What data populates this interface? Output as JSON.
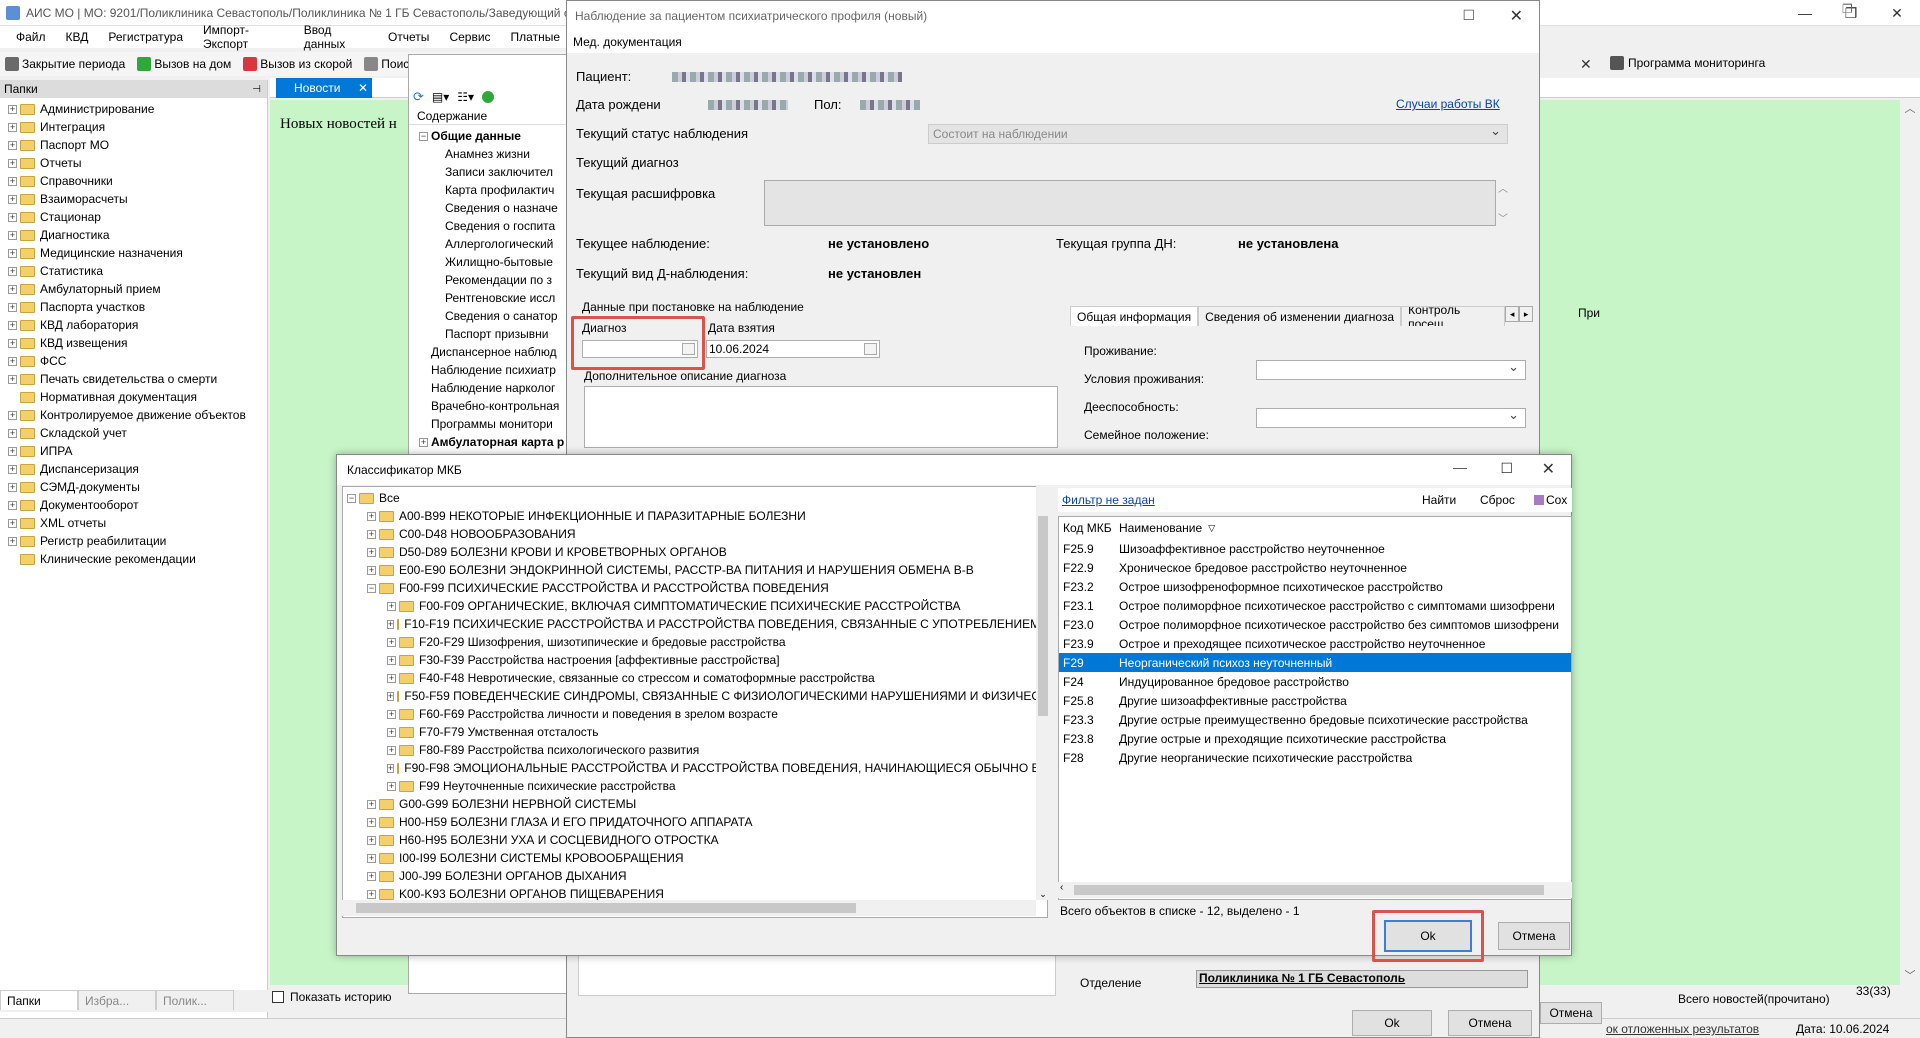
{
  "main_window": {
    "title": "АИС МО | МО: 9201/Поликлиника Севастополь/Поликлиника № 1 ГБ Севастополь/Заведующий с",
    "menu": [
      "Файл",
      "КВД",
      "Регистратура",
      "Импорт-Экспорт",
      "Ввод данных",
      "Отчеты",
      "Сервис",
      "Платные"
    ],
    "toolbar": [
      "Закрытие периода",
      "Вызов на дом",
      "Вызов из скорой",
      "Поиск"
    ],
    "right_toolbar": "Программа мониторинга"
  },
  "folders_panel": {
    "header": "Папки",
    "items": [
      "Администрирование",
      "Интеграция",
      "Паспорт МО",
      "Отчеты",
      "Справочники",
      "Взаиморасчеты",
      "Стационар",
      "Диагностика",
      "Медицинские назначения",
      "Статистика",
      "Амбулаторный прием",
      "Паспорта участков",
      "КВД лаборатория",
      "КВД извещения",
      "ФСС",
      "Печать свидетельства о смерти",
      "Нормативная документация",
      "Контролируемое движение объектов",
      "Складской учет",
      "ИПРА",
      "Диспансеризация",
      "СЭМД-документы",
      "Документооборот",
      "XML отчеты",
      "Регистр реабилитации",
      "Клинические рекомендации"
    ],
    "bottom_tabs": [
      "Папки",
      "Избра...",
      "Полик..."
    ]
  },
  "news": {
    "tab": "Новости",
    "text": "Новых новостей н",
    "show_history": "Показать историю",
    "read_count": "Всего новостей(прочитано)",
    "count": "33(33)"
  },
  "status_bar": {
    "deferred": "ок отложенных результатов",
    "date": "Дата: 10.06.2024"
  },
  "content_panel": {
    "header": "Содержание",
    "root": "Общие данные",
    "children": [
      "Анамнез жизни",
      "Записи заключител",
      "Карта профилактич",
      "Сведения о назначе",
      "Сведения о госпита",
      "Аллергологический",
      "Жилищно-бытовые",
      "Рекомендации по з",
      "Рентгеновские иссл",
      "Сведения о санатор",
      "Паспорт призывни"
    ],
    "others": [
      "Диспансерное наблюд",
      "Наблюдение психиатр",
      "Наблюдение нарколог",
      "Врачебно-контрольная",
      "Программы монитори"
    ],
    "last": "Амбулаторная карта р"
  },
  "observation_dialog": {
    "title": "Наблюдение за пациентом психиатрического профиля (новый)",
    "menu": "Мед. документация",
    "patient_label": "Пациент:",
    "dob_label": "Дата рождени",
    "sex_label": "Пол:",
    "vk_link": "Случаи работы ВК",
    "status_label": "Текущий статус наблюдения",
    "status_value": "Состоит на наблюдении",
    "diag_label": "Текущий диагноз",
    "decode_label": "Текущая расшифровка",
    "obs_label": "Текущее наблюдение:",
    "obs_value": "не установлено",
    "group_label": "Текущая группа ДН:",
    "group_value": "не установлена",
    "dtype_label": "Текущий вид Д-наблюдения:",
    "dtype_value": "не установлен",
    "section_label": "Данные при постановке на наблюдение",
    "diagnosis_field_label": "Диагноз",
    "date_field_label": "Дата взятия",
    "date_value": "10.06.2024",
    "extra_desc_label": "Дополнительное описание диагноза",
    "tabs": [
      "Общая информация",
      "Сведения об изменении диагноза",
      "Контроль посещ"
    ],
    "right_fields": [
      "Проживание:",
      "Условия проживания:",
      "Дееспособность:",
      "Семейное положение:"
    ],
    "department_label": "Отделение",
    "department_value": "Поликлиника № 1 ГБ Севастополь",
    "ok": "Ok",
    "cancel": "Отмена",
    "behind_cancel": "Отмена",
    "behind_pri": "При"
  },
  "mkb_dialog": {
    "title": "Классификатор МКБ",
    "tree_root": "Все",
    "tree": [
      {
        "label": "A00-B99 НЕКОТОРЫЕ ИНФЕКЦИОННЫЕ И ПАРАЗИТАРНЫЕ БОЛЕЗНИ",
        "level": 1,
        "exp": "+"
      },
      {
        "label": "C00-D48 НОВООБРАЗОВАНИЯ",
        "level": 1,
        "exp": "+"
      },
      {
        "label": "D50-D89 БОЛЕЗНИ КРОВИ И КРОВЕТВОРНЫХ ОРГАНОВ",
        "level": 1,
        "exp": "+"
      },
      {
        "label": "E00-E90 БОЛЕЗНИ ЭНДОКРИННОЙ СИСТЕМЫ, РАССТР-ВА ПИТАНИЯ И НАРУШЕНИЯ ОБМЕНА В-В",
        "level": 1,
        "exp": "+"
      },
      {
        "label": "F00-F99 ПСИХИЧЕСКИЕ РАССТРОЙСТВА И РАССТРОЙСТВА ПОВЕДЕНИЯ",
        "level": 1,
        "exp": "−"
      },
      {
        "label": "F00-F09 ОРГАНИЧЕСКИЕ, ВКЛЮЧАЯ СИМПТОМАТИЧЕСКИЕ ПСИХИЧЕСКИЕ РАССТРОЙСТВА",
        "level": 2,
        "exp": "+"
      },
      {
        "label": "F10-F19 ПСИХИЧЕСКИЕ РАССТРОЙСТВА И РАССТРОЙСТВА ПОВЕДЕНИЯ, СВЯЗАННЫЕ С УПОТРЕБЛЕНИЕМ ПСИ",
        "level": 2,
        "exp": "+"
      },
      {
        "label": "F20-F29 Шизофрения, шизотипические и бредовые расстройства",
        "level": 2,
        "exp": "+"
      },
      {
        "label": "F30-F39 Расстройства настроения [аффективные расстройства]",
        "level": 2,
        "exp": "+"
      },
      {
        "label": "F40-F48 Невротические, связанные со стрессом и соматоформные расстройства",
        "level": 2,
        "exp": "+"
      },
      {
        "label": "F50-F59 ПОВЕДЕНЧЕСКИЕ СИНДРОМЫ, СВЯЗАННЫЕ С ФИЗИОЛОГИЧЕСКИМИ НАРУШЕНИЯМИ И ФИЗИЧЕСК",
        "level": 2,
        "exp": "+"
      },
      {
        "label": "F60-F69 Расстройства личности и поведения в зрелом возрасте",
        "level": 2,
        "exp": "+"
      },
      {
        "label": "F70-F79 Умственная отсталость",
        "level": 2,
        "exp": "+"
      },
      {
        "label": "F80-F89 Расстройства психологического развития",
        "level": 2,
        "exp": "+"
      },
      {
        "label": "F90-F98 ЭМОЦИОНАЛЬНЫЕ РАССТРОЙСТВА И РАССТРОЙСТВА ПОВЕДЕНИЯ, НАЧИНАЮЩИЕСЯ ОБЫЧНО В ДЕ",
        "level": 2,
        "exp": "+"
      },
      {
        "label": "F99 Неуточненные психические расстройства",
        "level": 2,
        "exp": "+"
      },
      {
        "label": "G00-G99 БОЛЕЗНИ НЕРВНОЙ СИСТЕМЫ",
        "level": 1,
        "exp": "+"
      },
      {
        "label": "H00-H59 БОЛЕЗНИ ГЛАЗА И ЕГО ПРИДАТОЧНОГО АППАРАТА",
        "level": 1,
        "exp": "+"
      },
      {
        "label": "H60-H95 БОЛЕЗНИ УХА И СОСЦЕВИДНОГО ОТРОСТКА",
        "level": 1,
        "exp": "+"
      },
      {
        "label": "I00-I99 БОЛЕЗНИ СИСТЕМЫ КРОВООБРАЩЕНИЯ",
        "level": 1,
        "exp": "+"
      },
      {
        "label": "J00-J99 БОЛЕЗНИ ОРГАНОВ ДЫХАНИЯ",
        "level": 1,
        "exp": "+"
      },
      {
        "label": "K00-K93 БОЛЕЗНИ ОРГАНОВ ПИЩЕВАРЕНИЯ",
        "level": 1,
        "exp": "+"
      }
    ],
    "filter_link": "Фильтр не задан",
    "find": "Найти",
    "reset": "Сброс",
    "save": "Сох",
    "col_code": "Код МКБ",
    "col_name": "Наименование",
    "rows": [
      {
        "code": "F25.9",
        "name": "Шизоаффективное расстройство неуточненное"
      },
      {
        "code": "F22.9",
        "name": "Хроническое бредовое расстройство неуточненное"
      },
      {
        "code": "F23.2",
        "name": "Острое шизофреноформное психотическое расстройство"
      },
      {
        "code": "F23.1",
        "name": "Острое полиморфное психотическое расстройство с симптомами шизофрени"
      },
      {
        "code": "F23.0",
        "name": "Острое полиморфное психотическое расстройство без симптомов шизофрени"
      },
      {
        "code": "F23.9",
        "name": "Острое и преходящее психотическое расстройство неуточненное"
      },
      {
        "code": "F29",
        "name": "Неорганический психоз неуточненный",
        "selected": true
      },
      {
        "code": "F24",
        "name": "Индуцированное бредовое расстройство"
      },
      {
        "code": "F25.8",
        "name": "Другие шизоаффективные расстройства"
      },
      {
        "code": "F23.3",
        "name": "Другие острые преимущественно бредовые психотические расстройства"
      },
      {
        "code": "F23.8",
        "name": "Другие острые и преходящие психотические расстройства"
      },
      {
        "code": "F28",
        "name": "Другие неорганические психотические расстройства"
      }
    ],
    "footer": "Всего объектов в списке - 12, выделено - 1",
    "ok": "Ok",
    "cancel": "Отмена"
  },
  "colors": {
    "accent": "#0078d7",
    "highlight_box": "#d9534f",
    "news_bg": "#c8f5c8"
  }
}
